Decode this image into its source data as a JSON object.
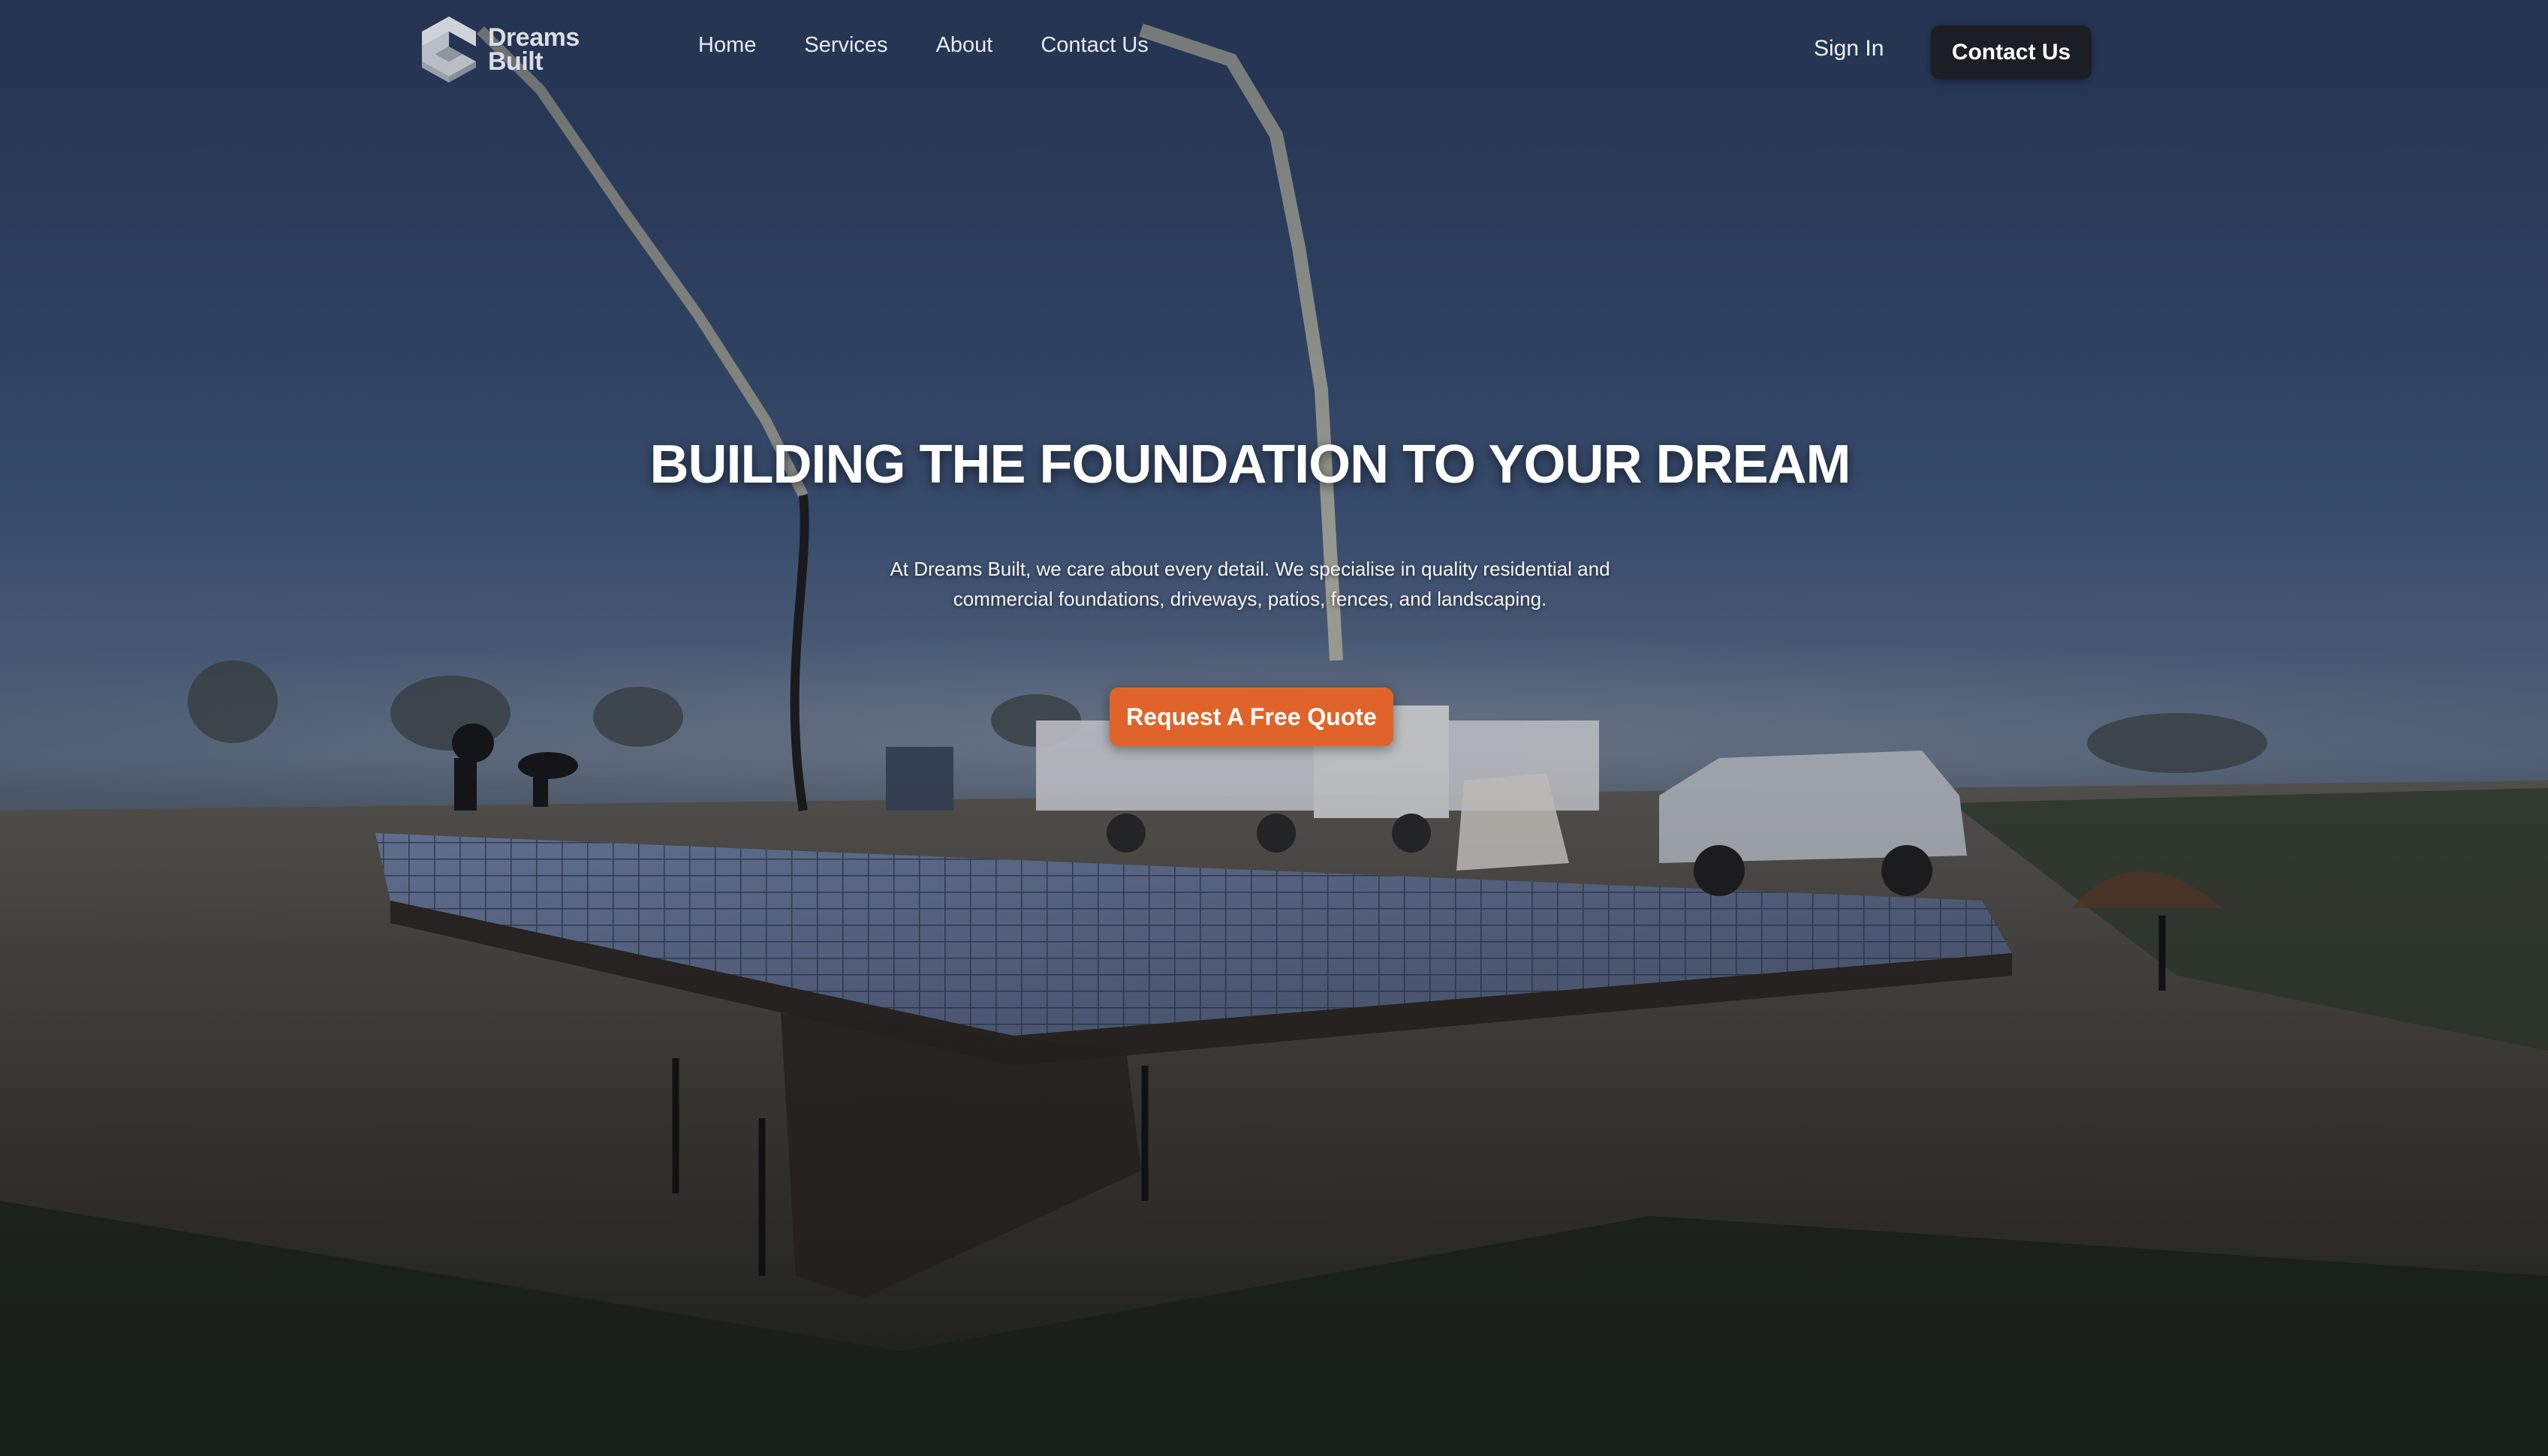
{
  "brand": {
    "line1": "Dreams",
    "line2": "Built",
    "logo_icon": "stacked-cube-logo-icon"
  },
  "nav": {
    "links": [
      {
        "label": "Home"
      },
      {
        "label": "Services"
      },
      {
        "label": "About"
      },
      {
        "label": "Contact Us"
      }
    ],
    "sign_in": "Sign In",
    "contact_button": "Contact Us"
  },
  "hero": {
    "headline": "BUILDING THE FOUNDATION TO YOUR DREAM",
    "description": "At Dreams Built, we care about every detail. We specialise in quality residential and commercial foundations, driveways, patios, fences, and landscaping.",
    "cta": "Request A Free Quote",
    "background": "concrete-foundation-site-photo"
  },
  "colors": {
    "accent": "#e0642a",
    "dark_button": "#1c1e26",
    "sky": "#2f4566"
  }
}
